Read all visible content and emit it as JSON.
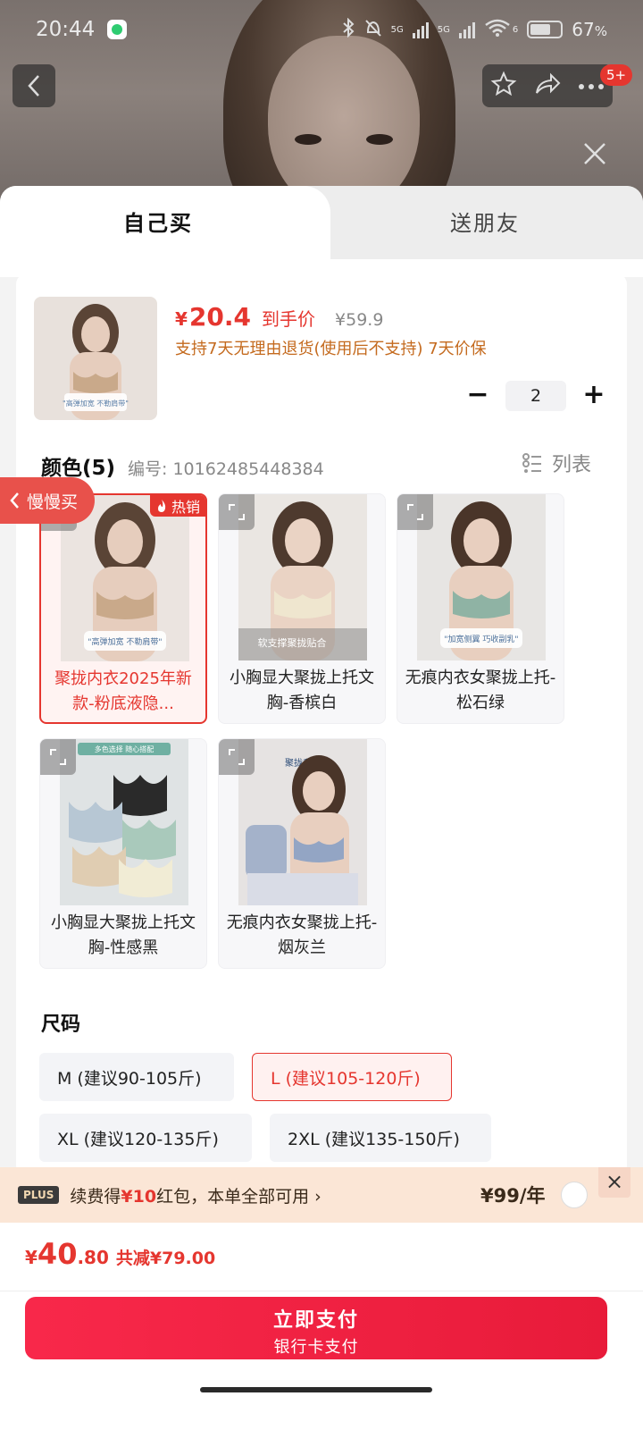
{
  "status_bar": {
    "time": "20:44",
    "battery": "67",
    "battery_unit": "%",
    "net_a": "5G",
    "net_b": "5G",
    "wifi": "6"
  },
  "nav": {
    "badge": "5+"
  },
  "tabs": {
    "self": "自己买",
    "friend": "送朋友"
  },
  "product": {
    "price_currency": "¥",
    "price_value": "20.4",
    "price_tag": "到手价",
    "original_price": "¥59.9",
    "policy": "支持7天无理由退货(使用后不支持) 7天价保",
    "quantity": "2",
    "thumb_caption": "\"高弹加宽 不勒肩带\""
  },
  "color_section": {
    "title": "颜色(5)",
    "code_label": "编号: 10162485448384",
    "list_toggle": "列表",
    "hot_badge": "热销",
    "slow_buy": "慢慢买",
    "options": [
      {
        "label": "聚拢内衣2025年新款-粉底液隐...",
        "selected": true,
        "tone": "#c9a98a",
        "caption": "\"高弹加宽 不勒肩带\""
      },
      {
        "label": "小胸显大聚拢上托文胸-香槟白",
        "selected": false,
        "tone": "#efe6cf",
        "caption": "软支撑聚拢贴合"
      },
      {
        "label": "无痕内衣女聚拢上托-松石绿",
        "selected": false,
        "tone": "#8fb3a4",
        "caption": "\"加宽侧翼 巧收副乳\""
      },
      {
        "label": "小胸显大聚拢上托文胸-性感黑",
        "selected": false,
        "tone": "#2a2a2a",
        "caption": "多色选择 随心搭配"
      },
      {
        "label": "无痕内衣女聚拢上托-烟灰兰",
        "selected": false,
        "tone": "#93a5c4",
        "caption": "聚拢升杯"
      }
    ]
  },
  "size_section": {
    "title": "尺码",
    "options": [
      {
        "label": "M (建议90-105斤)",
        "selected": false
      },
      {
        "label": "L (建议105-120斤)",
        "selected": true
      },
      {
        "label": "XL (建议120-135斤)",
        "selected": false
      },
      {
        "label": "2XL (建议135-150斤)",
        "selected": false
      }
    ]
  },
  "plus_bar": {
    "logo": "PLUS",
    "text_prefix": "续费得",
    "text_amount": "¥10",
    "text_suffix": "红包，本单全部可用",
    "chevron": "›",
    "price": "¥99/年",
    "close": "×"
  },
  "total": {
    "currency": "¥",
    "integer": "40",
    "decimal": ".80",
    "discount": "共减¥79.00"
  },
  "pay_button": {
    "main": "立即支付",
    "sub": "银行卡支付"
  },
  "colors": {
    "accent": "#e5362f",
    "pay": "#f8284a",
    "policy": "#c46a1e"
  }
}
